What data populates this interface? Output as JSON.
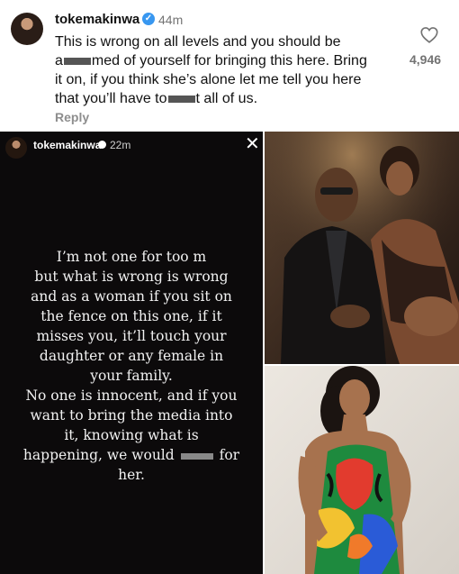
{
  "comment": {
    "username": "tokemakinwa",
    "time": "44m",
    "text_line1": "This is wrong on all levels and you should be",
    "text_line2a": "a",
    "text_line2b": "med of yourself for bringing this here. Bring",
    "text_line3": "it on, if you think she’s alone let me tell you here",
    "text_line4a": "that you’ll have to",
    "text_line4b": "t all of us.",
    "reply_label": "Reply",
    "likes": "4,946",
    "heart_icon": "heart-outline-icon"
  },
  "story": {
    "username": "tokemakinwa",
    "time": "22m",
    "close_icon": "close-icon",
    "line1": "I’m not one for too m",
    "line2": "but what is wrong is wrong",
    "line3": "and as a woman if you sit on",
    "line4": "the fence on this one, if it",
    "line5": "misses you, it’ll touch your",
    "line6": "daughter or any female in",
    "line7": "your family.",
    "line8": "No one is innocent, and if you",
    "line9": "want to bring the media into",
    "line10": "it, knowing what is",
    "line11a": "happening, we would",
    "line11b": "for",
    "line12": "her."
  },
  "colors": {
    "verified": "#3897f0",
    "story_bg": "#0c0a0b",
    "muted": "#737373"
  }
}
